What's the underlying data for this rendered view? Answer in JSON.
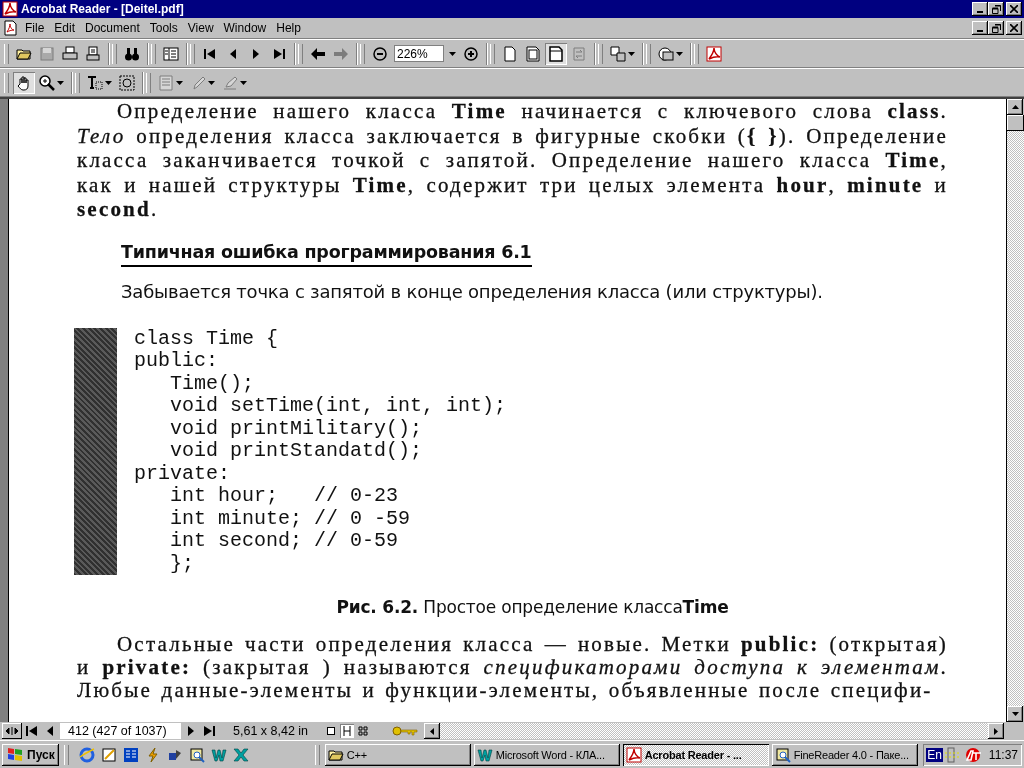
{
  "window": {
    "title": "Acrobat Reader - [Deitel.pdf]"
  },
  "menu": [
    "File",
    "Edit",
    "Document",
    "Tools",
    "View",
    "Window",
    "Help"
  ],
  "toolbar": [
    {
      "kind": "open",
      "disabled": false,
      "selected": false
    },
    {
      "kind": "save",
      "disabled": true,
      "selected": false
    },
    {
      "kind": "print",
      "disabled": false,
      "selected": false
    },
    {
      "kind": "setup",
      "disabled": false,
      "selected": false
    },
    {
      "kind": "sep"
    },
    {
      "kind": "find",
      "disabled": false,
      "selected": false
    },
    {
      "kind": "sep"
    },
    {
      "kind": "panel",
      "disabled": false,
      "selected": false
    },
    {
      "kind": "sep"
    },
    {
      "kind": "first",
      "disabled": false,
      "selected": false
    },
    {
      "kind": "prev",
      "disabled": false,
      "selected": false
    },
    {
      "kind": "next",
      "disabled": false,
      "selected": false
    },
    {
      "kind": "last",
      "disabled": false,
      "selected": false
    },
    {
      "kind": "sep"
    },
    {
      "kind": "back",
      "disabled": false,
      "selected": false
    },
    {
      "kind": "forward",
      "disabled": true,
      "selected": false
    },
    {
      "kind": "sep"
    },
    {
      "kind": "zoomout",
      "disabled": false,
      "selected": false
    },
    {
      "kind": "zoomfield",
      "value": "226%"
    },
    {
      "kind": "zoomin",
      "disabled": false,
      "selected": false
    },
    {
      "kind": "sep"
    },
    {
      "kind": "actual",
      "disabled": false,
      "selected": false
    },
    {
      "kind": "fitpage",
      "disabled": false,
      "selected": false
    },
    {
      "kind": "fitwidth",
      "disabled": false,
      "selected": true
    },
    {
      "kind": "reflow",
      "disabled": true,
      "selected": false
    },
    {
      "kind": "sep"
    },
    {
      "kind": "layout",
      "disabled": false,
      "selected": false,
      "dropdown": true
    },
    {
      "kind": "sep"
    },
    {
      "kind": "clip",
      "disabled": false,
      "selected": false,
      "dropdown": true
    },
    {
      "kind": "sep"
    },
    {
      "kind": "acrobat",
      "disabled": false,
      "selected": false
    }
  ],
  "tools": [
    {
      "kind": "hand",
      "disabled": false,
      "selected": true
    },
    {
      "kind": "zoomtool",
      "disabled": false,
      "selected": false,
      "dropdown": true
    },
    {
      "kind": "sep"
    },
    {
      "kind": "text",
      "disabled": false,
      "selected": false,
      "dropdown": true
    },
    {
      "kind": "graphic",
      "disabled": false,
      "selected": false
    },
    {
      "kind": "sep"
    },
    {
      "kind": "note",
      "disabled": true,
      "selected": false,
      "dropdown": true
    },
    {
      "kind": "pencil",
      "disabled": true,
      "selected": false,
      "dropdown": true
    },
    {
      "kind": "highlight",
      "disabled": true,
      "selected": false,
      "dropdown": true
    }
  ],
  "document": {
    "intro": "Определение нашего класса **Time** начинается с ключевого слова **class**. *Тело* определения класса заключается в фигурные скобки (**{ }**). Определение класса заканчивается точкой с запятой. Определение нашего класса **Time**, как и нашей структуры **Time**, содержит три целых элемента **hour**, **minute** и **second**.",
    "tip_heading": "Типичная ошибка программирования 6.1",
    "tip_text": "Забывается точка с запятой в конце определения класса (или структуры).",
    "code": [
      "class Time {",
      "public:",
      "   Time();",
      "   void setTime(int, int, int);",
      "   void printMilitary();",
      "   void printStandatd();",
      "private:",
      "   int hour;   // 0-23",
      "   int minute; // 0 -59",
      "   int second; // 0-59",
      "   };"
    ],
    "caption": "**Рис. 6.2.** Простое определение класса**Time**",
    "body": "Остальные части определения класса — новые. Метки **public:** (открытая) и **private:** (закрытая ) называются *спецификаторами доступа к элементам*. Любые данные-элементы и функции-элементы, объявленные после специфи-"
  },
  "status_bar": {
    "page": "412 (427 of 1037)",
    "size": "5,61 x 8,42 in",
    "views": [
      {
        "selected": false
      },
      {
        "selected": true
      },
      {
        "selected": false
      }
    ]
  },
  "taskbar": {
    "start": "Пуск",
    "quick_launch": [
      {
        "kind": "ie"
      },
      {
        "kind": "notepad"
      },
      {
        "kind": "book"
      },
      {
        "kind": "winamp"
      },
      {
        "kind": "program"
      },
      {
        "kind": "search"
      },
      {
        "kind": "word"
      },
      {
        "kind": "excel"
      }
    ],
    "tasks": [
      {
        "kind": "folder",
        "label": "C++",
        "selected": false
      },
      {
        "kind": "word",
        "label": "Microsoft Word - КЛА...",
        "selected": false
      },
      {
        "kind": "acrobat",
        "label": "Acrobat Reader - ...",
        "selected": true
      },
      {
        "kind": "finereader",
        "label": "FineReader 4.0 - Паке...",
        "selected": false
      }
    ],
    "language": "En",
    "clock": "11:37"
  }
}
